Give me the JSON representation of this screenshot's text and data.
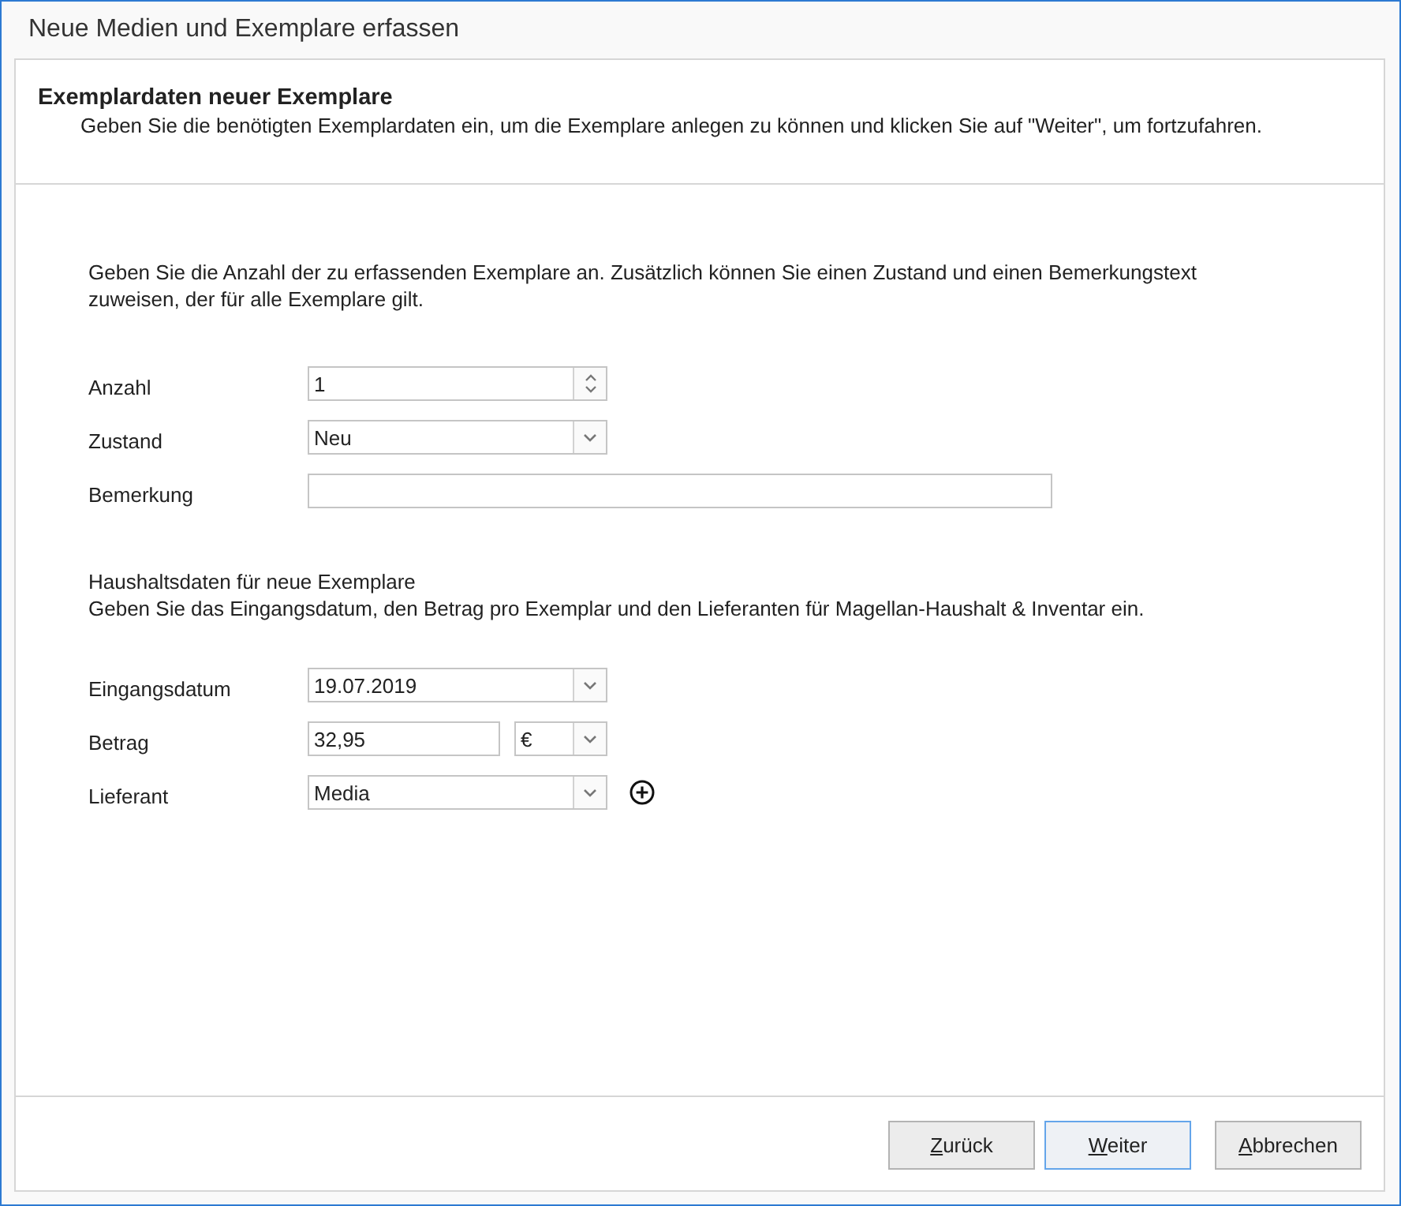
{
  "window": {
    "title": "Neue Medien und Exemplare erfassen"
  },
  "header": {
    "title": "Exemplardaten neuer Exemplare",
    "description": "Geben Sie die benötigten Exemplardaten ein, um die Exemplare anlegen zu können und klicken Sie auf \"Weiter\", um fortzufahren."
  },
  "sections": [
    {
      "intro": "Geben Sie die Anzahl der zu erfassenden Exemplare an. Zusätzlich können Sie einen Zustand und einen Bemerkungstext zuweisen, der für alle Exemplare gilt.",
      "rows": [
        {
          "label": "Anzahl",
          "controls": [
            {
              "kind": "spin",
              "value": "1"
            }
          ]
        },
        {
          "label": "Zustand",
          "controls": [
            {
              "kind": "dropdown",
              "value": "Neu"
            }
          ]
        },
        {
          "label": "Bemerkung",
          "controls": [
            {
              "kind": "text"
            }
          ]
        }
      ]
    },
    {
      "heading": "Haushaltsdaten für neue Exemplare",
      "intro": "Geben Sie das Eingangsdatum, den Betrag pro Exemplar und den Lieferanten für Magellan-Haushalt & Inventar ein.",
      "rows": [
        {
          "label": "Eingangsdatum",
          "controls": [
            {
              "kind": "dropdown",
              "value": "19.07.2019"
            }
          ]
        },
        {
          "label": "Betrag",
          "controls": [
            {
              "kind": "amount",
              "value": "32,95"
            },
            {
              "kind": "currency",
              "value": "€"
            }
          ]
        },
        {
          "label": "Lieferant",
          "controls": [
            {
              "kind": "dropdown",
              "value": "Media"
            },
            {
              "kind": "add"
            }
          ]
        }
      ]
    }
  ],
  "buttons": [
    {
      "label": "Zurück",
      "focused": false,
      "access_key_shown": true
    },
    {
      "label": "Weiter",
      "focused": true,
      "access_key_shown": true
    },
    {
      "label": "Abbrechen",
      "focused": false,
      "access_key_shown": true
    }
  ]
}
